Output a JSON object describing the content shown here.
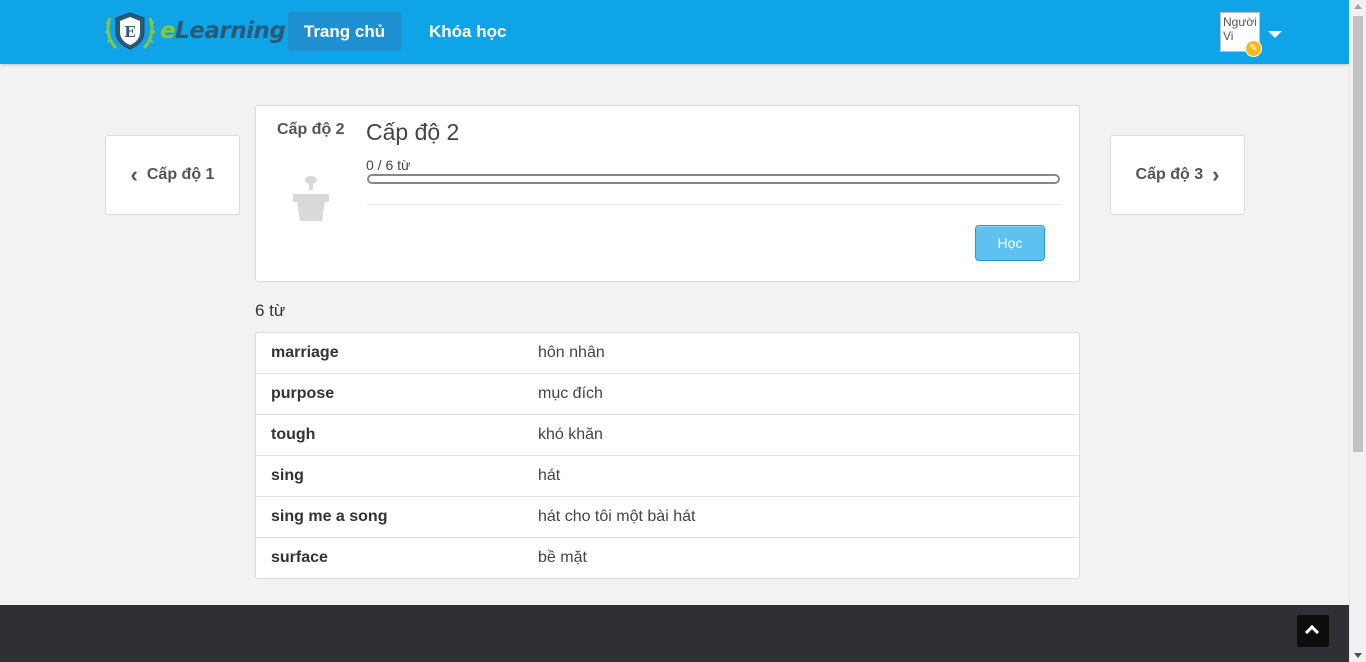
{
  "navbar": {
    "logo_letter": "E",
    "logo_prefix": "e",
    "logo_rest": "Learning",
    "items": [
      {
        "label": "Trang chủ",
        "active": true
      },
      {
        "label": "Khóa học",
        "active": false
      }
    ],
    "avatar_alt": "Người Vi",
    "accent_color": "#0fa3e8"
  },
  "level_nav": {
    "prev_label": "Cấp độ 1",
    "next_label": "Cấp độ 3"
  },
  "level": {
    "tag": "Cấp độ 2",
    "title": "Cấp độ 2",
    "progress_text": "0 / 6 từ",
    "progress_fraction": 0,
    "learn_button": "Học",
    "icon": "plant-pot-icon"
  },
  "words": {
    "count_label": "6 từ",
    "items": [
      {
        "en": "marriage",
        "vi": "hôn nhân"
      },
      {
        "en": "purpose",
        "vi": "mục đích"
      },
      {
        "en": "tough",
        "vi": "khó khăn"
      },
      {
        "en": "sing",
        "vi": "hát"
      },
      {
        "en": "sing me a song",
        "vi": "hát cho tôi một bài hát"
      },
      {
        "en": "surface",
        "vi": "bề mặt"
      }
    ]
  }
}
